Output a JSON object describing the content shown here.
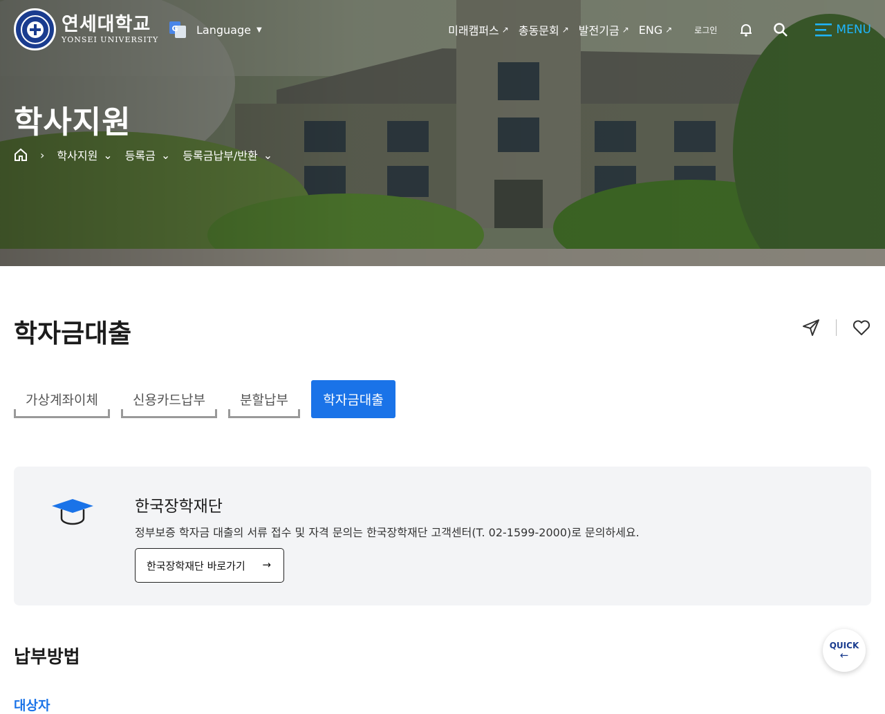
{
  "header": {
    "logo_kor": "연세대학교",
    "logo_eng": "YONSEI UNIVERSITY",
    "language_label": "Language",
    "links": [
      {
        "label": "미래캠퍼스",
        "icon": "external-arrow-icon"
      },
      {
        "label": "총동문회",
        "icon": "external-arrow-icon"
      },
      {
        "label": "발전기금",
        "icon": "external-arrow-icon"
      },
      {
        "label": "ENG",
        "icon": "external-arrow-icon"
      }
    ],
    "login_label": "로그인",
    "menu_label": "MENU"
  },
  "hero": {
    "title": "학사지원",
    "breadcrumb": [
      "학사지원",
      "등록금",
      "등록금납부/반환"
    ]
  },
  "main": {
    "page_title": "학자금대출",
    "tabs": [
      {
        "label": "가상계좌이체",
        "active": false
      },
      {
        "label": "신용카드납부",
        "active": false
      },
      {
        "label": "분할납부",
        "active": false
      },
      {
        "label": "학자금대출",
        "active": true
      }
    ],
    "info": {
      "title": "한국장학재단",
      "description": "정부보증 학자금 대출의 서류 접수 및 자격 문의는 한국장학재단 고객센터(T. 02-1599-2000)로 문의하세요.",
      "button_label": "한국장학재단 바로가기"
    },
    "section_title": "납부방법",
    "subsection_title": "대상자"
  },
  "quick": {
    "label": "QUICK"
  },
  "colors": {
    "accent": "#1a73e8",
    "menu": "#1fb6ff",
    "brand": "#1a3c8f",
    "box_bg": "#f3f4f6"
  }
}
